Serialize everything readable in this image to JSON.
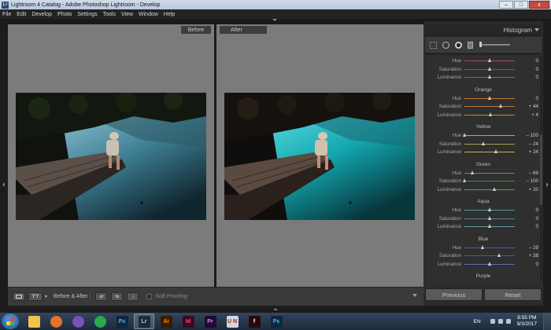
{
  "window": {
    "title": "Lightroom 4 Catalog - Adobe Photoshop Lightroom - Develop",
    "app_icon": "Lr",
    "buttons": {
      "minimize": "–",
      "maximize": "□",
      "close": "x"
    }
  },
  "menu": [
    "File",
    "Edit",
    "Develop",
    "Photo",
    "Settings",
    "Tools",
    "View",
    "Window",
    "Help"
  ],
  "viewer": {
    "before_label": "Before",
    "after_label": "After"
  },
  "toolbar": {
    "before_after_label": "Before & After :",
    "soft_proofing_label": "Soft Proofing",
    "yy_label": "YY"
  },
  "right_panel": {
    "histogram_label": "Histogram",
    "groups": [
      {
        "name": "",
        "rows": [
          {
            "label": "Hue",
            "value": "0",
            "pos": 0.5,
            "color": "#b04a4a"
          },
          {
            "label": "Saturation",
            "value": "0",
            "pos": 0.5,
            "color": "#9a4a4a"
          },
          {
            "label": "Luminance",
            "value": "0",
            "pos": 0.5,
            "color": "#aa5555"
          }
        ]
      },
      {
        "name": "Orange",
        "rows": [
          {
            "label": "Hue",
            "value": "0",
            "pos": 0.5,
            "color": "#c07a3a"
          },
          {
            "label": "Saturation",
            "value": "+ 44",
            "pos": 0.72,
            "color": "#b07a4a"
          },
          {
            "label": "Luminance",
            "value": "+ 4",
            "pos": 0.52,
            "color": "#c08a4a"
          }
        ]
      },
      {
        "name": "Yellow",
        "rows": [
          {
            "label": "Hue",
            "value": "– 100",
            "pos": 0.0,
            "color": "#b8b040"
          },
          {
            "label": "Saturation",
            "value": "– 24",
            "pos": 0.38,
            "color": "#a8a050"
          },
          {
            "label": "Luminance",
            "value": "+ 24",
            "pos": 0.62,
            "color": "#c0b850"
          }
        ]
      },
      {
        "name": "Green",
        "rows": [
          {
            "label": "Hue",
            "value": "– 69",
            "pos": 0.16,
            "color": "#5a9a4a"
          },
          {
            "label": "Saturation",
            "value": "– 100",
            "pos": 0.0,
            "color": "#4a8a4a"
          },
          {
            "label": "Luminance",
            "value": "+ 20",
            "pos": 0.6,
            "color": "#5aa05a"
          }
        ]
      },
      {
        "name": "Aqua",
        "rows": [
          {
            "label": "Hue",
            "value": "0",
            "pos": 0.5,
            "color": "#4a9a9a"
          },
          {
            "label": "Saturation",
            "value": "0",
            "pos": 0.5,
            "color": "#4a8a8a"
          },
          {
            "label": "Luminance",
            "value": "0",
            "pos": 0.5,
            "color": "#5aa0a0"
          }
        ]
      },
      {
        "name": "Blue",
        "rows": [
          {
            "label": "Hue",
            "value": "– 29",
            "pos": 0.36,
            "color": "#4a5aaa"
          },
          {
            "label": "Saturation",
            "value": "+ 38",
            "pos": 0.69,
            "color": "#4a5a9a"
          },
          {
            "label": "Luminance",
            "value": "0",
            "pos": 0.5,
            "color": "#5a6ab0"
          }
        ]
      },
      {
        "name": "Purple",
        "rows": []
      }
    ],
    "previous_label": "Previous",
    "reset_label": "Reset"
  },
  "taskbar": {
    "apps": [
      {
        "name": "explorer",
        "label": ""
      },
      {
        "name": "firefox",
        "label": ""
      },
      {
        "name": "viber",
        "label": ""
      },
      {
        "name": "vpn",
        "label": ""
      },
      {
        "name": "photoshop",
        "label": "Ps"
      },
      {
        "name": "lightroom",
        "label": "Lr"
      },
      {
        "name": "illustrator",
        "label": "Ai"
      },
      {
        "name": "indesign",
        "label": "Id"
      },
      {
        "name": "premiere",
        "label": "Pr"
      },
      {
        "name": "uni",
        "label": "U N"
      },
      {
        "name": "flash",
        "label": "f"
      },
      {
        "name": "photoshop-2",
        "label": "Ps"
      }
    ],
    "language": "EN",
    "time": "8:55 PM",
    "date": "9/3/2017"
  }
}
